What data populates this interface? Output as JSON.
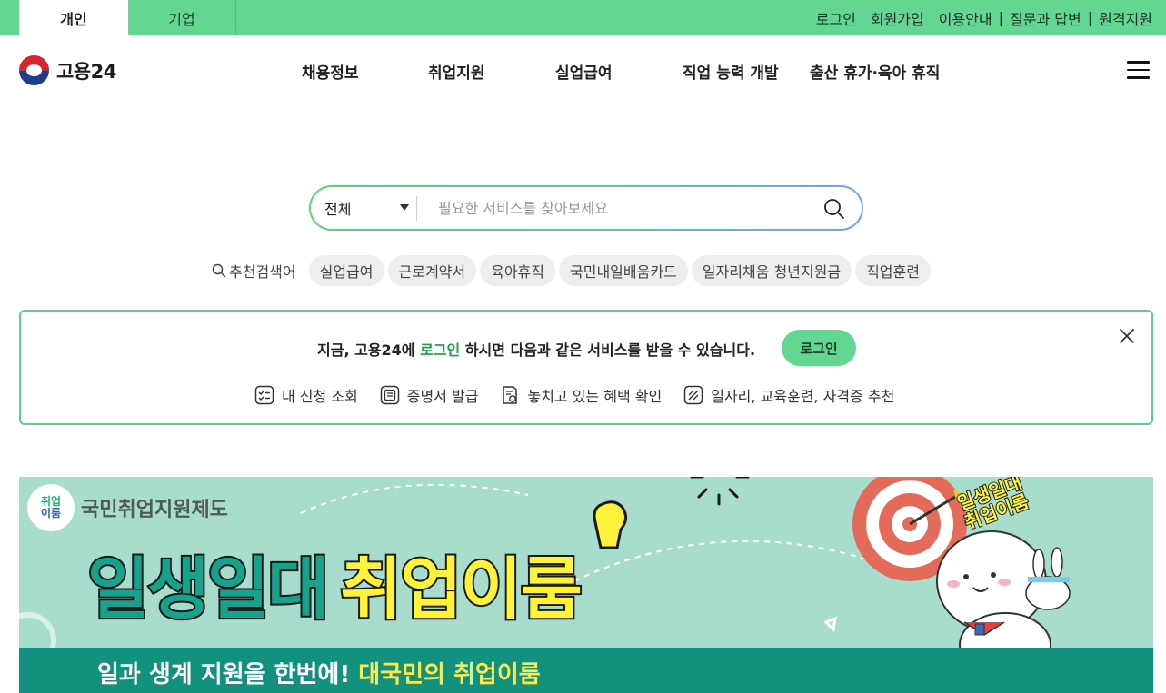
{
  "topbar": {
    "tabs": [
      "개인",
      "기업"
    ],
    "links": [
      "로그인",
      "회원가입",
      "이용안내",
      "질문과 답변",
      "원격지원"
    ]
  },
  "header": {
    "logo_text": "고용24",
    "nav": [
      "채용정보",
      "취업지원",
      "실업급여",
      "직업 능력 개발",
      "출산 휴가·육아 휴직"
    ]
  },
  "search": {
    "scope": "전체",
    "placeholder": "필요한 서비스를 찾아보세요"
  },
  "keywords": {
    "label": "추천검색어",
    "items": [
      "실업급여",
      "근로계약서",
      "육아휴직",
      "국민내일배움카드",
      "일자리채움 청년지원금",
      "직업훈련"
    ]
  },
  "login_banner": {
    "msg_before": "지금, 고용24에 ",
    "msg_link": "로그인",
    "msg_after": " 하시면 다음과 같은 서비스를 받을 수 있습니다.",
    "button": "로그인",
    "services": [
      "내 신청 조회",
      "증명서 발급",
      "놓치고 있는 혜택 확인",
      "일자리, 교육훈련, 자격증 추천"
    ]
  },
  "promo": {
    "badge_line1": "취업",
    "badge_line2": "이룸",
    "program": "국민취업지원제도",
    "headline_part1": "일생일대",
    "headline_part2": "취업이룸",
    "sub_part1": "일과 생계 지원을 한번에! ",
    "sub_part2": "대국민의 취업이룸",
    "sticker_line1": "일생일대",
    "sticker_line2": "취업이룸"
  },
  "colors": {
    "brand_green": "#63d692",
    "accent_text_green": "#1a9e50",
    "promo_bg": "#a8dccd",
    "promo_band": "#12927e"
  }
}
